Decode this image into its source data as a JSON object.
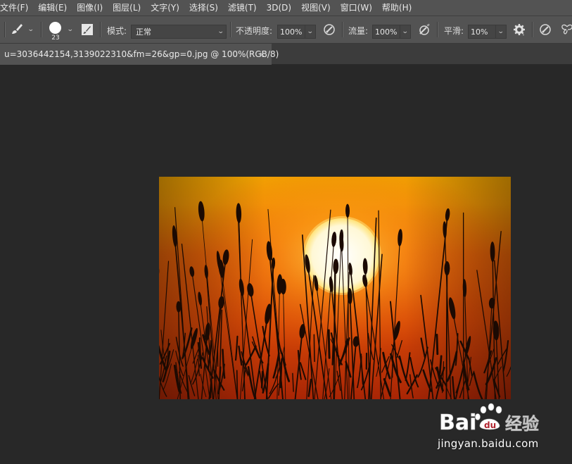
{
  "menubar": {
    "items": [
      "文件(F)",
      "编辑(E)",
      "图像(I)",
      "图层(L)",
      "文字(Y)",
      "选择(S)",
      "滤镜(T)",
      "3D(D)",
      "视图(V)",
      "窗口(W)",
      "帮助(H)"
    ]
  },
  "options": {
    "brush_size": "23",
    "mode_label": "模式:",
    "mode_value": "正常",
    "opacity_label": "不透明度:",
    "opacity_value": "100%",
    "flow_label": "流量:",
    "flow_value": "100%",
    "smoothing_label": "平滑:",
    "smoothing_value": "10%"
  },
  "document": {
    "tab_title": "u=3036442154,3139022310&fm=26&gp=0.jpg @ 100%(RGB/8)",
    "close_glyph": "×"
  },
  "watermark": {
    "brand_left": "Bai",
    "brand_du": "du",
    "brand_right": "经验",
    "url": "jingyan.baidu.com"
  },
  "colors": {
    "ui_panel": "#535353",
    "canvas_bg": "#282828",
    "sky_top": "#f5a200",
    "sky_bottom": "#b92a05",
    "sun": "#fffbe8"
  }
}
